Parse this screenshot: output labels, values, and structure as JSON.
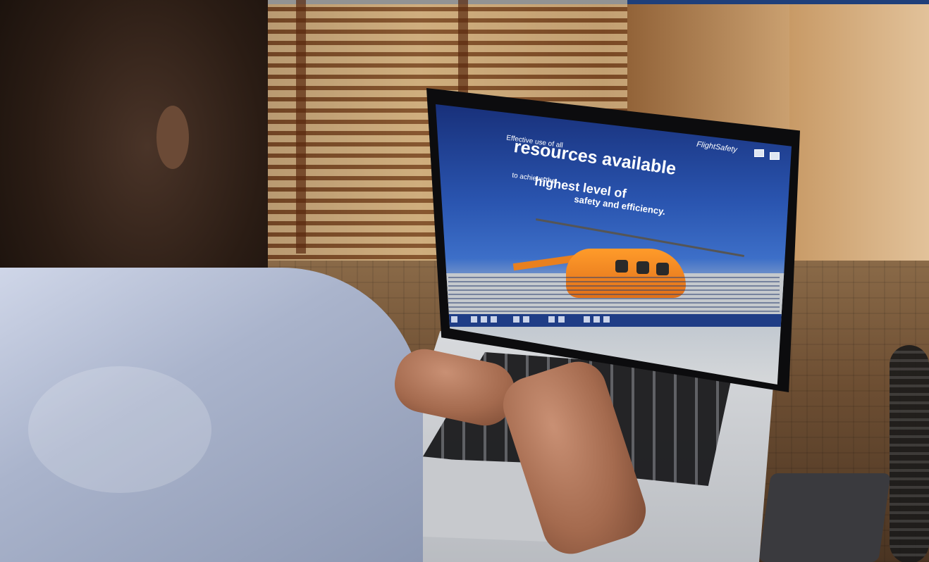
{
  "scene": {
    "description_alt": "Person using a laptop showing an online training course",
    "top_bar_color": "#1f3f7a"
  },
  "screen": {
    "line1": "Effective use of all",
    "line2": "resources available",
    "line3": "to achieve the",
    "line4": "highest level of",
    "line5": "safety and efficiency.",
    "brand": "FlightSafety",
    "accent_color": "#2a55b0",
    "aircraft": "orange helicopter"
  }
}
